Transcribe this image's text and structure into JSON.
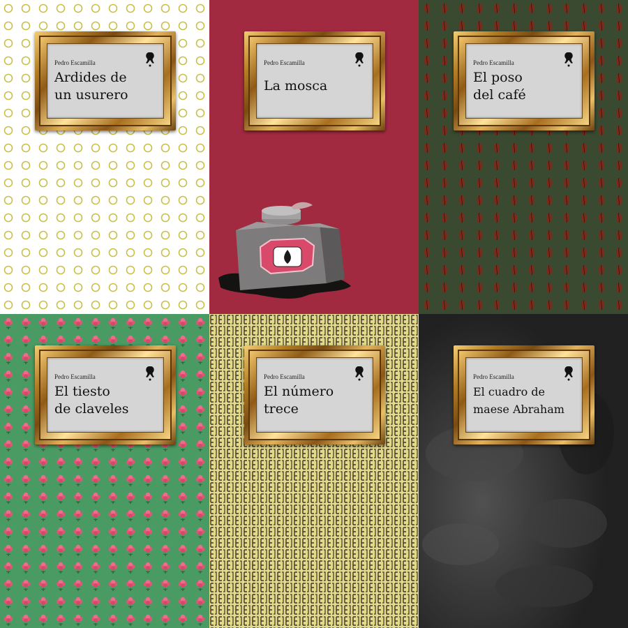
{
  "author": "Pedro Escamilla",
  "covers": [
    {
      "title_line1": "Ardides de",
      "title_line2": "un usurero",
      "background": "#ffffff",
      "pattern": "rings-icon",
      "pattern_color": "#c9c04a"
    },
    {
      "title_line1": "La mosca",
      "title_line2": "",
      "background": "#a22a40",
      "pattern": "inkwell-icon",
      "pattern_color": "#3a3a3a"
    },
    {
      "title_line1": "El poso",
      "title_line2": "del café",
      "background": "#3a4a30",
      "pattern": "coffee-bean-icon",
      "pattern_color": "#7a2b1c"
    },
    {
      "title_line1": "El tiesto",
      "title_line2": "de claveles",
      "background": "#4a9a63",
      "pattern": "carnation-icon",
      "pattern_color": "#e25575"
    },
    {
      "title_line1": "El número",
      "title_line2": "trece",
      "background": "#e3d98b",
      "pattern": "number-glyph-icon",
      "pattern_color": "#3a3528"
    },
    {
      "title_line1": "El cuadro de",
      "title_line2": "maese Abraham",
      "background": "#2b2b2b",
      "pattern": "dark-texture-icon",
      "pattern_color": "#555555"
    }
  ]
}
